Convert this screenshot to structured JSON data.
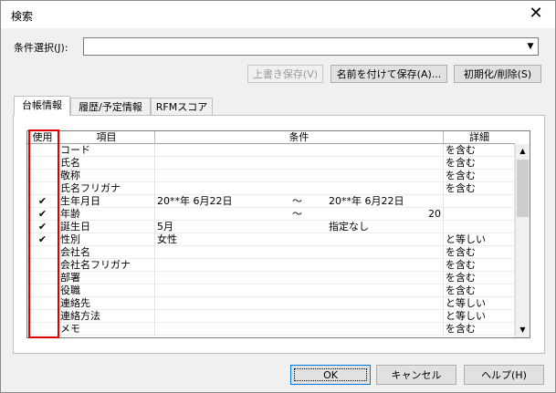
{
  "window": {
    "title": "検索",
    "close_glyph": "✕"
  },
  "condition": {
    "label": "条件選択(J):",
    "value": "",
    "arrow": "▼"
  },
  "buttons": {
    "overwrite_save": "上書き保存(V)",
    "save_as": "名前を付けて保存(A)...",
    "reset_delete": "初期化/削除(S)",
    "ok": "OK",
    "cancel": "キャンセル",
    "help": "ヘルプ(H)"
  },
  "tabs": [
    "台帳情報",
    "履歴/予定情報",
    "RFMスコア"
  ],
  "grid": {
    "headers": [
      "使用",
      "項目",
      "条件",
      "詳細"
    ],
    "check_glyph": "✔",
    "rows": [
      {
        "use": false,
        "item": "コード",
        "cond1": "",
        "sep": "",
        "cond2": "",
        "detail": "を含む"
      },
      {
        "use": false,
        "item": "氏名",
        "cond1": "",
        "sep": "",
        "cond2": "",
        "detail": "を含む"
      },
      {
        "use": false,
        "item": "敬称",
        "cond1": "",
        "sep": "",
        "cond2": "",
        "detail": "を含む"
      },
      {
        "use": false,
        "item": "氏名フリガナ",
        "cond1": "",
        "sep": "",
        "cond2": "",
        "detail": "を含む"
      },
      {
        "use": true,
        "item": "生年月日",
        "cond1": "20**年 6月22日",
        "sep": "～",
        "cond2": "20**年 6月22日",
        "detail": ""
      },
      {
        "use": true,
        "item": "年齢",
        "cond1": "",
        "sep": "～",
        "cond2": "20",
        "detail": ""
      },
      {
        "use": true,
        "item": "誕生日",
        "cond1": "5月",
        "sep": "",
        "cond2": "指定なし",
        "detail": ""
      },
      {
        "use": true,
        "item": "性別",
        "cond1": "女性",
        "sep": "",
        "cond2": "",
        "detail": "と等しい"
      },
      {
        "use": false,
        "item": "会社名",
        "cond1": "",
        "sep": "",
        "cond2": "",
        "detail": "を含む"
      },
      {
        "use": false,
        "item": "会社名フリガナ",
        "cond1": "",
        "sep": "",
        "cond2": "",
        "detail": "を含む"
      },
      {
        "use": false,
        "item": "部署",
        "cond1": "",
        "sep": "",
        "cond2": "",
        "detail": "を含む"
      },
      {
        "use": false,
        "item": "役職",
        "cond1": "",
        "sep": "",
        "cond2": "",
        "detail": "を含む"
      },
      {
        "use": false,
        "item": "連絡先",
        "cond1": "",
        "sep": "",
        "cond2": "",
        "detail": "と等しい"
      },
      {
        "use": false,
        "item": "連絡方法",
        "cond1": "",
        "sep": "",
        "cond2": "",
        "detail": "と等しい"
      },
      {
        "use": false,
        "item": "メモ",
        "cond1": "",
        "sep": "",
        "cond2": "",
        "detail": "を含む"
      }
    ],
    "scroll_up": "▲",
    "scroll_down": "▼"
  },
  "colors": {
    "highlight_box": "#e10000"
  }
}
